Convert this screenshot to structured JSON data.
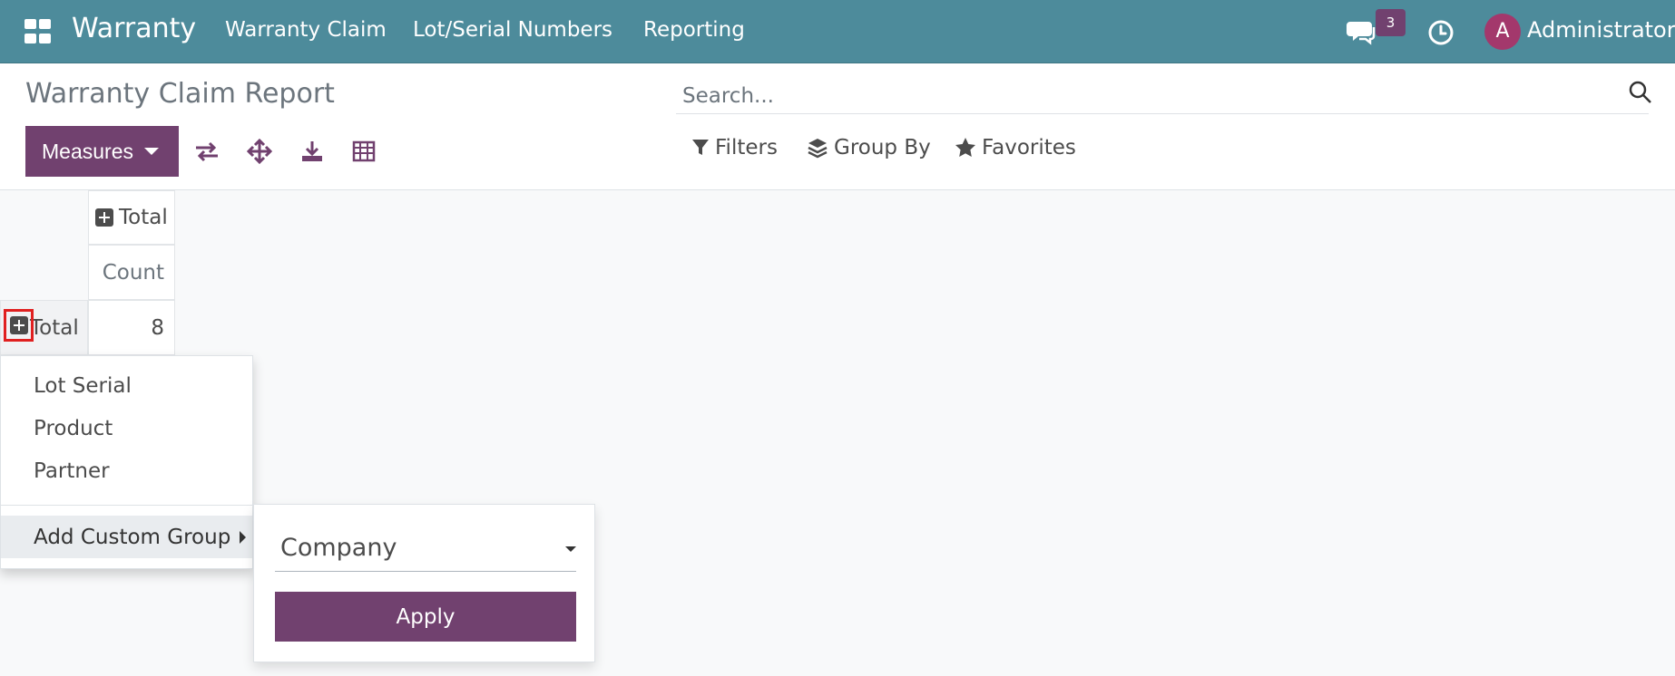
{
  "navbar": {
    "brand": "Warranty",
    "menu": [
      {
        "label": "Warranty Claim"
      },
      {
        "label": "Lot/Serial Numbers"
      },
      {
        "label": "Reporting"
      }
    ],
    "messages_badge": "3",
    "avatar_letter": "A",
    "user_name": "Administrator",
    "icons": [
      "apps-icon",
      "chat-icon",
      "clock-icon"
    ]
  },
  "control_panel": {
    "title": "Warranty Claim Report",
    "measures_label": "Measures",
    "search_placeholder": "Search...",
    "filters_label": "Filters",
    "group_by_label": "Group By",
    "favorites_label": "Favorites",
    "tools": [
      "flip-axis-icon",
      "expand-all-icon",
      "download-icon",
      "table-icon"
    ]
  },
  "pivot": {
    "col_header": "Total",
    "measure_header": "Count",
    "row_header": "Total",
    "value": "8"
  },
  "groupby_dropdown": {
    "items": [
      {
        "label": "Lot Serial"
      },
      {
        "label": "Product"
      },
      {
        "label": "Partner"
      }
    ],
    "custom_group_label": "Add Custom Group",
    "custom_field_selected": "Company",
    "apply_label": "Apply"
  },
  "colors": {
    "navbar": "#4d8b9b",
    "primary": "#71416f",
    "avatar": "#a3386c",
    "highlight": "#e02020"
  }
}
